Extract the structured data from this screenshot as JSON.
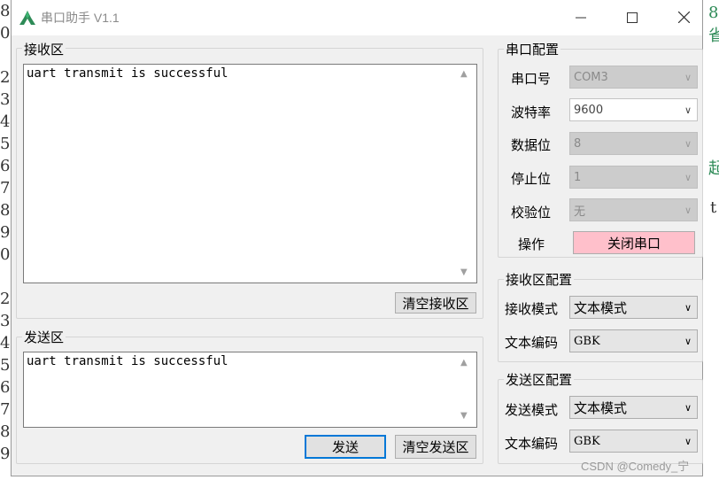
{
  "background": {
    "left_glyphs": [
      "8",
      "0",
      "",
      "2",
      "3",
      "4",
      "5",
      "6",
      "7",
      "8",
      "9",
      "0",
      "",
      "2",
      "3",
      "4",
      "5",
      "6",
      "7",
      "8",
      "9"
    ],
    "right_fragments": [
      "8",
      "省",
      "起",
      "t"
    ]
  },
  "window": {
    "title": "串口助手 V1.1",
    "receive_area": {
      "label": "接收区",
      "content": "uart transmit is successful",
      "clear_button": "清空接收区"
    },
    "send_area": {
      "label": "发送区",
      "content": "uart transmit is successful",
      "send_button": "发送",
      "clear_button": "清空发送区"
    },
    "serial_config": {
      "label": "串口配置",
      "port": {
        "label": "串口号",
        "value": "COM3"
      },
      "baud": {
        "label": "波特率",
        "value": "9600"
      },
      "data_bits": {
        "label": "数据位",
        "value": "8"
      },
      "stop_bits": {
        "label": "停止位",
        "value": "1"
      },
      "parity": {
        "label": "校验位",
        "value": "无"
      },
      "operation": {
        "label": "操作",
        "button": "关闭串口"
      }
    },
    "receive_config": {
      "label": "接收区配置",
      "mode": {
        "label": "接收模式",
        "value": "文本模式"
      },
      "encoding": {
        "label": "文本编码",
        "value": "GBK"
      }
    },
    "send_config": {
      "label": "发送区配置",
      "mode": {
        "label": "发送模式",
        "value": "文本模式"
      },
      "encoding": {
        "label": "文本编码",
        "value": "GBK"
      }
    }
  },
  "watermark": "CSDN @Comedy_宁",
  "colors": {
    "close_port_bg": "#ffc0cb",
    "focus_border": "#0078d7",
    "app_icon": "#2e8b57"
  }
}
